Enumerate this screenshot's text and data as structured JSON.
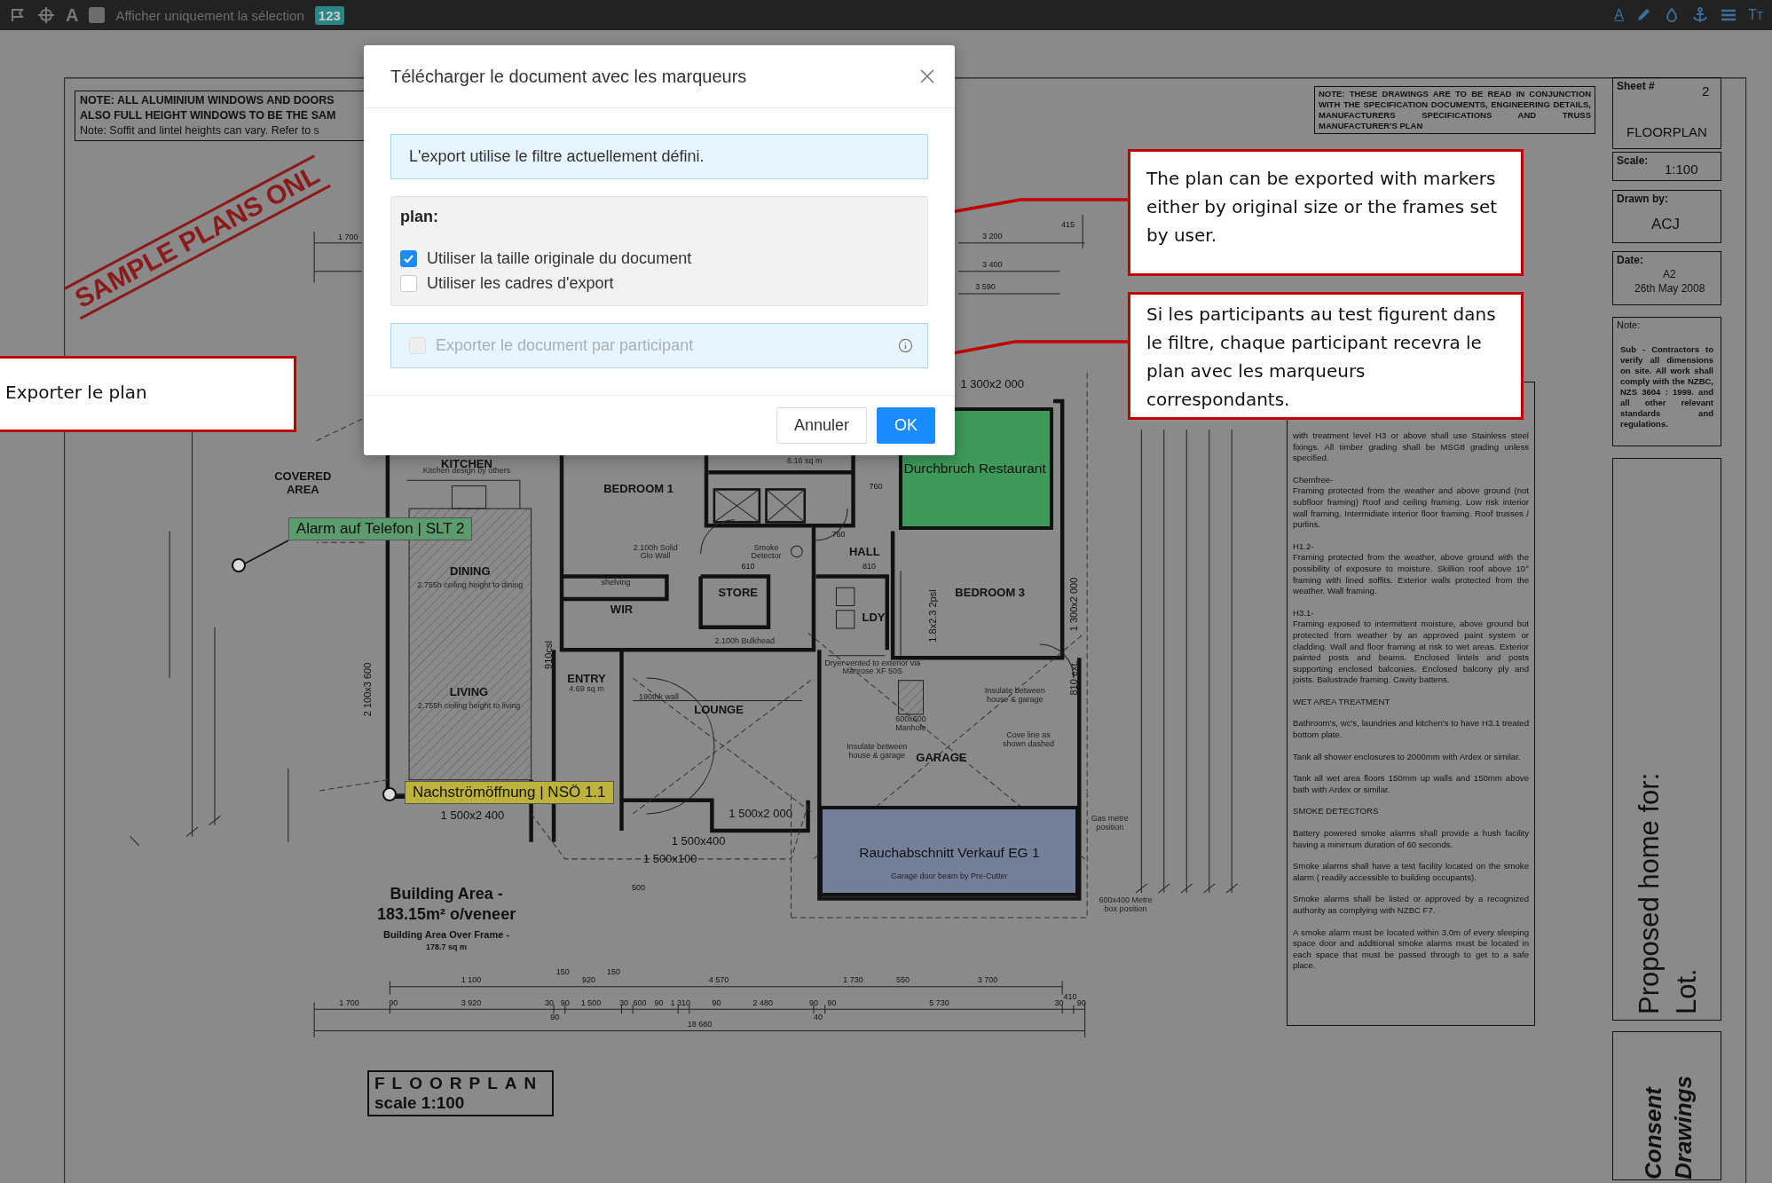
{
  "toolbar": {
    "text_tool": "A",
    "show_selection_only": {
      "label": "Afficher uniquement la sélection",
      "checked": false
    },
    "badge": "123",
    "right_glyphs": [
      "A",
      "Tт"
    ]
  },
  "drawing": {
    "notes_box": [
      "NOTE: ALL ALUMINIUM WINDOWS AND DOORS",
      "ALSO FULL HEIGHT WINDOWS TO BE THE SAM",
      "Note: Soffit and lintel heights can vary. Refer to s"
    ],
    "stamp": "SAMPLE PLANS ONL",
    "spec_note": "NOTE: THESE DRAWINGS ARE TO BE READ IN CONJUNCTION WITH THE SPECIFICATION DOCUMENTS, ENGINEERING DETAILS, MANUFACTURERS SPECIFICATIONS AND TRUSS MANUFACTURER'S PLAN",
    "plan_texts": [
      {
        "kind": "room",
        "text": "COVERED AREA"
      },
      {
        "kind": "room",
        "text": "KITCHEN"
      },
      {
        "kind": "room",
        "text": "BEDROOM 1"
      },
      {
        "kind": "room",
        "text": "HALL"
      },
      {
        "kind": "room",
        "text": "BEDROOM 3"
      },
      {
        "kind": "room",
        "text": "STORE"
      },
      {
        "kind": "room",
        "text": "WIR"
      },
      {
        "kind": "room",
        "text": "LDY"
      },
      {
        "kind": "room",
        "text": "DINING"
      },
      {
        "kind": "room",
        "text": "LIVING"
      },
      {
        "kind": "room",
        "text": "ENTRY"
      },
      {
        "kind": "room",
        "text": "LOUNGE"
      },
      {
        "kind": "room",
        "text": "GARAGE"
      },
      {
        "kind": "note",
        "text": "Kitchen design by others"
      },
      {
        "kind": "note",
        "text": "6.16 sq m"
      },
      {
        "kind": "note",
        "text": "2.100h Solid Glo Wall"
      },
      {
        "kind": "note",
        "text": "shelving"
      },
      {
        "kind": "note",
        "text": "Smoke Detector"
      },
      {
        "kind": "note",
        "text": "2.100h Bulkhead"
      },
      {
        "kind": "note",
        "text": "Dryer vented to exterior via Manrose XF 50S"
      },
      {
        "kind": "note",
        "text": "600x600 Manhole"
      },
      {
        "kind": "note",
        "text": "Insulate between house & garage"
      },
      {
        "kind": "note",
        "text": "Cove line as shown dashed"
      },
      {
        "kind": "note",
        "text": "Insulate between house & garage"
      },
      {
        "kind": "note",
        "text": "190thk wall"
      },
      {
        "kind": "note",
        "text": "4.69 sq m"
      },
      {
        "kind": "note",
        "text": "2.755h ceiling height to dining"
      },
      {
        "kind": "note",
        "text": "2.755h ceiling height to living"
      },
      {
        "kind": "note",
        "text": "Garage door beam by Pre-Cutter"
      },
      {
        "kind": "note",
        "text": "Gas metre position"
      },
      {
        "kind": "note",
        "text": "600x400 Metre box position"
      },
      {
        "kind": "dimlg",
        "text": "1 300x2 000"
      },
      {
        "kind": "dimlg",
        "text": "1 500x2 400"
      },
      {
        "kind": "dimlg",
        "text": "1 500x2 000"
      },
      {
        "kind": "dimlg",
        "text": "1 500x400"
      },
      {
        "kind": "dimlg",
        "text": "1 500x100"
      },
      {
        "kind": "dim",
        "text": "760"
      },
      {
        "kind": "dim",
        "text": "760"
      },
      {
        "kind": "dim",
        "text": "610"
      },
      {
        "kind": "dim",
        "text": "810"
      },
      {
        "kind": "dim",
        "text": "500"
      },
      {
        "kind": "dim",
        "text": "1 700"
      },
      {
        "kind": "dim",
        "text": "3 200"
      },
      {
        "kind": "dim",
        "text": "3 400"
      },
      {
        "kind": "dim",
        "text": "3 590"
      },
      {
        "kind": "dim",
        "text": "415"
      },
      {
        "kind": "dim",
        "text": "1 100"
      },
      {
        "kind": "dim",
        "text": "150"
      },
      {
        "kind": "dim",
        "text": "920"
      },
      {
        "kind": "dim",
        "text": "150"
      },
      {
        "kind": "dim",
        "text": "4 570"
      },
      {
        "kind": "dim",
        "text": "1 730"
      },
      {
        "kind": "dim",
        "text": "550"
      },
      {
        "kind": "dim",
        "text": "3 700"
      },
      {
        "kind": "dim",
        "text": "410"
      },
      {
        "kind": "dim",
        "text": "1 700"
      },
      {
        "kind": "dim",
        "text": "90"
      },
      {
        "kind": "dim",
        "text": "3 920"
      },
      {
        "kind": "dim",
        "text": "30"
      },
      {
        "kind": "dim",
        "text": "90"
      },
      {
        "kind": "dim",
        "text": "1 500"
      },
      {
        "kind": "dim",
        "text": "30"
      },
      {
        "kind": "dim",
        "text": "600"
      },
      {
        "kind": "dim",
        "text": "90"
      },
      {
        "kind": "dim",
        "text": "1 310"
      },
      {
        "kind": "dim",
        "text": "90"
      },
      {
        "kind": "dim",
        "text": "2 480"
      },
      {
        "kind": "dim",
        "text": "90"
      },
      {
        "kind": "dim",
        "text": "90"
      },
      {
        "kind": "dim",
        "text": "5 730"
      },
      {
        "kind": "dim",
        "text": "30"
      },
      {
        "kind": "dim",
        "text": "90"
      },
      {
        "kind": "dim",
        "text": "90"
      },
      {
        "kind": "dim",
        "text": "40"
      },
      {
        "kind": "dim",
        "text": "18 680"
      },
      {
        "kind": "vdim",
        "text": "2 100x3 600"
      },
      {
        "kind": "vdim",
        "text": "1 300x2 000"
      },
      {
        "kind": "vdim",
        "text": "810 ext."
      },
      {
        "kind": "vdim",
        "text": "910csl"
      },
      {
        "kind": "vdim",
        "text": "1.8x2.3 2psl"
      }
    ],
    "building_area": {
      "title": "Building Area -",
      "value": "183.15m² o/veneer",
      "frame_label": "Building Area Over Frame -",
      "frame_value": "178.7 sq m"
    },
    "plan_title": {
      "title": "FLOORPLAN",
      "scale": "scale 1:100"
    },
    "specifications": [
      {
        "kind": "text",
        "text": "with treatment level H3 or above shall use Stainless steel fixings. All timber grading shall be MSG8 grading unless specified."
      },
      {
        "kind": "subhead",
        "text": "Chemfree-"
      },
      {
        "kind": "text",
        "text": "Framing protected from the weather and above ground (not subfloor framing) Roof and ceiling framing. Low risk interior wall framing. Intermidiate interior floor framing. Roof trusses / purlins."
      },
      {
        "kind": "subhead",
        "text": "H1.2-"
      },
      {
        "kind": "text",
        "text": "Framing protected from the weather, above ground with the possibility of exposure to moisture. Skillion roof above 10° framing with lined soffits. Exterior walls protected from the weather. Wall framing."
      },
      {
        "kind": "subhead",
        "text": "H3.1-"
      },
      {
        "kind": "text",
        "text": "Framing exposed to intermittent moisture, above ground but protected from weather by an approved paint system or cladding. Wall and floor framing at risk to wet areas. Exterior painted posts and beams. Enclosed lintels and posts supporting enclosed balconies. Enclosed balcony ply and joists. Balustrade framing. Cavity battens."
      },
      {
        "kind": "text",
        "text": "WET AREA TREATMENT"
      },
      {
        "kind": "text",
        "text": "Bathroom's, wc's, laundries and kitchen's to have H3.1 treated bottom plate."
      },
      {
        "kind": "text",
        "text": "Tank all shower enclosures to 2000mm with Ardex or similar."
      },
      {
        "kind": "text",
        "text": "Tank all wet area floors 150mm up walls and 150mm above bath with Ardex or similar."
      },
      {
        "kind": "text",
        "text": "SMOKE DETECTORS"
      },
      {
        "kind": "text",
        "text": "Battery powered smoke alarms shall provide a hush facility having a minimum duration of 60 seconds."
      },
      {
        "kind": "text",
        "text": "Smoke alarms shall have a test facility located on the smoke alarm ( readily accessible to building occupants)."
      },
      {
        "kind": "text",
        "text": "Smoke alarms shall be listed or approved by a recognized authority as complying with NZBC F7."
      },
      {
        "kind": "text",
        "text": "A smoke alarm must be located within 3.0m of every sleeping space door and additional smoke alarms must be located in each space that must be passed through to get to a safe place."
      }
    ],
    "title_block": {
      "sheet_label": "Sheet #",
      "sheet": "2",
      "drawing_name": "FLOORPLAN",
      "scale_label": "Scale:",
      "scale": "1:100",
      "drawn_by_label": "Drawn by:",
      "drawn_by": "ACJ",
      "date_label": "Date:",
      "size": "A2",
      "date": "26th May 2008",
      "note_label": "Note:",
      "note": "Sub - Contractors to verify all dimensions on site. All work shall comply with the NZBC, NZS 3604 : 1999. and all other relevant standards and regulations.",
      "proposed": "Proposed home for:",
      "lot": "Lot.",
      "consent": "Consent Drawings"
    }
  },
  "markers": [
    {
      "kind": "pin",
      "label": "Alarm auf Telefon | SLT 2",
      "color": "#5c9b6d"
    },
    {
      "kind": "area",
      "label": "Durchbruch Restaurant",
      "color": "#3d9a58"
    },
    {
      "kind": "pin",
      "label": "Nachströmöffnung | NSÖ 1.1",
      "color": "#bdb23c"
    },
    {
      "kind": "area",
      "label": "Rauchabschnitt Verkauf EG 1",
      "color": "#747f9a"
    }
  ],
  "dialog": {
    "title": "Télécharger le document avec les marqueurs",
    "info": "L'export utilise le filtre actuellement défini.",
    "group_label": "plan:",
    "options": [
      {
        "label": "Utiliser la taille originale du document",
        "checked": true
      },
      {
        "label": "Utiliser les cadres d'export",
        "checked": false
      }
    ],
    "participant": {
      "label": "Exporter le document par participant",
      "checked": false,
      "disabled": true
    },
    "buttons": [
      {
        "label": "Annuler",
        "kind": "secondary"
      },
      {
        "label": "OK",
        "kind": "primary"
      }
    ]
  },
  "callouts": [
    "Exporter le plan",
    "The plan can be exported with markers either by original size or the frames set by user.",
    "Si les participants au test figurent dans le filtre, chaque participant recevra le plan avec les marqueurs correspondants."
  ]
}
